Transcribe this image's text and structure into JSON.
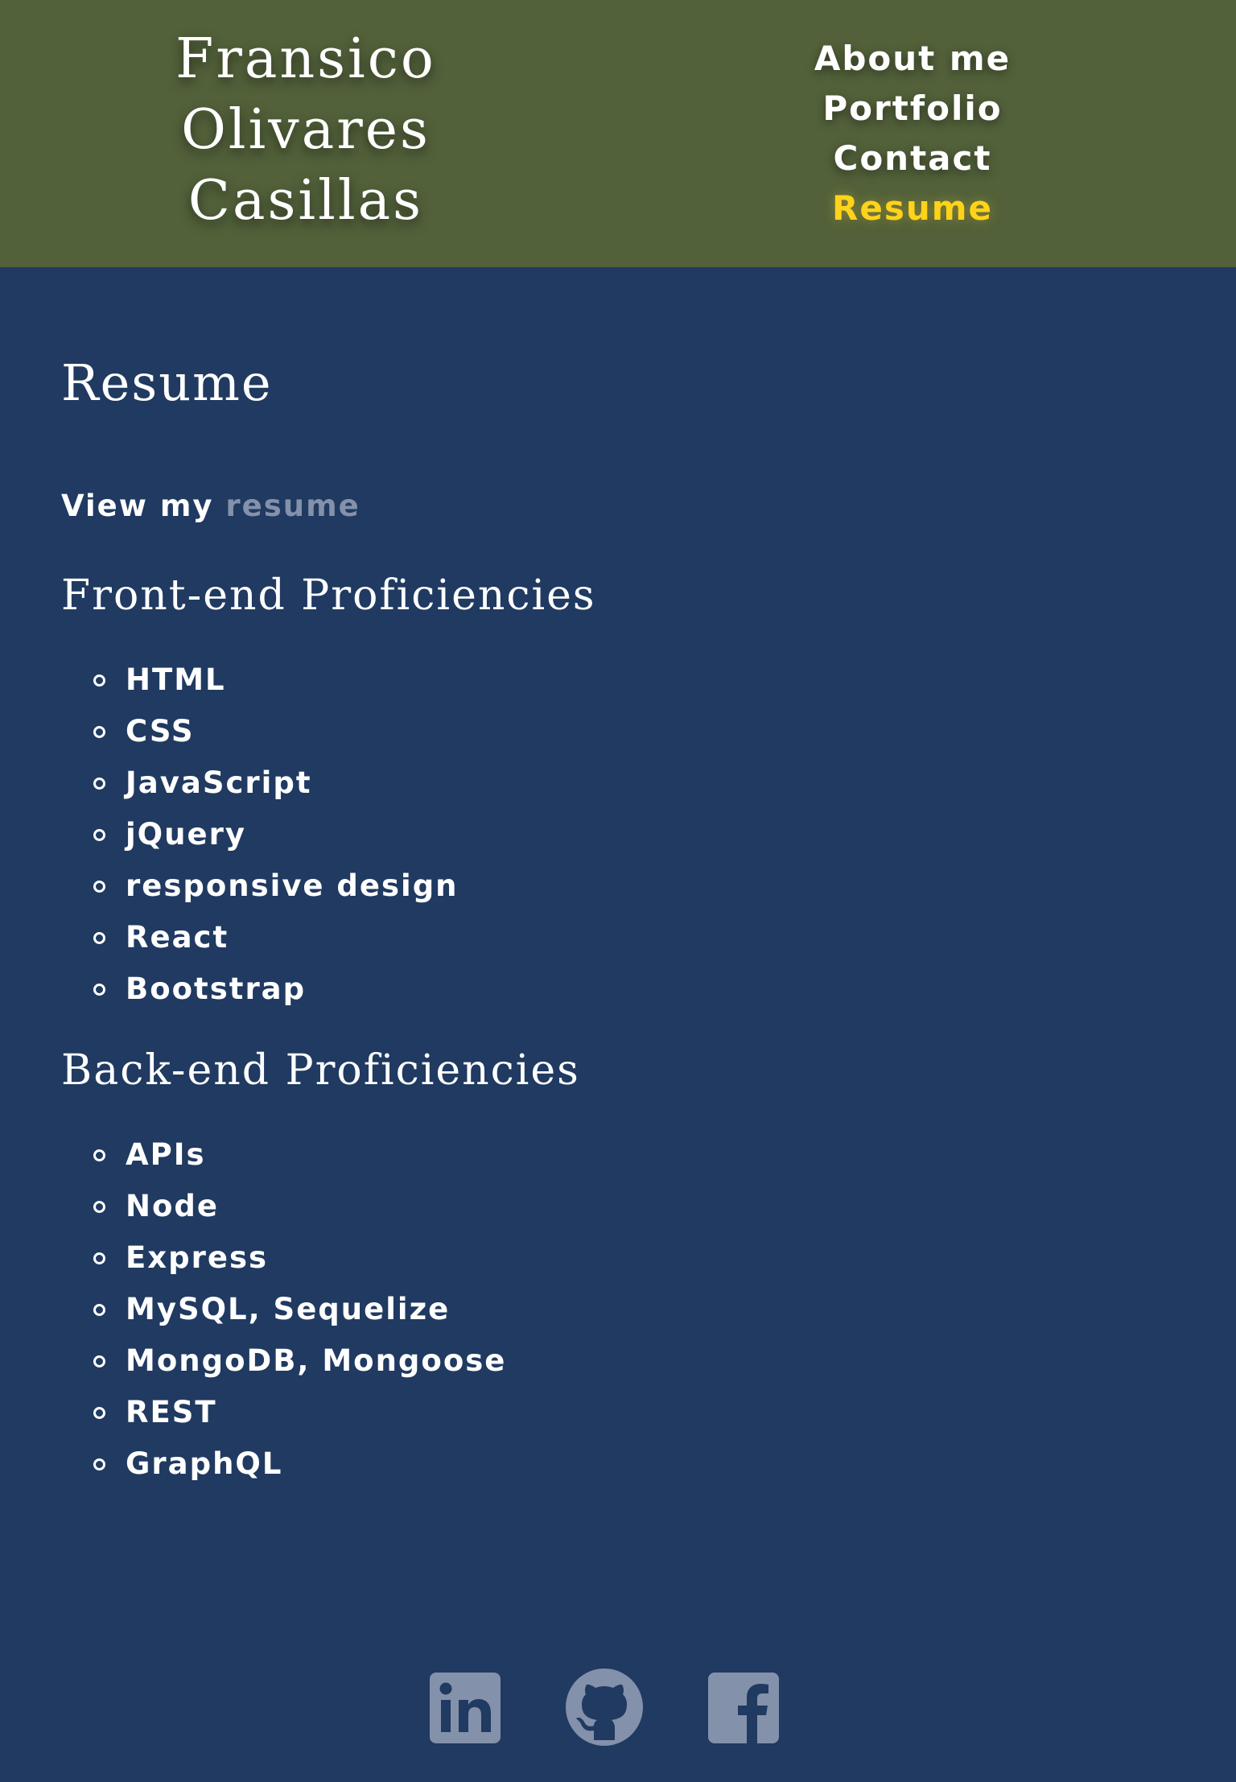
{
  "header": {
    "title_line1": "Fransico Olivares",
    "title_line2": "Casillas"
  },
  "nav": {
    "items": [
      {
        "label": "About me"
      },
      {
        "label": "Portfolio"
      },
      {
        "label": "Contact"
      },
      {
        "label": "Resume",
        "active": true
      }
    ]
  },
  "colors": {
    "header_bg": "#52613a",
    "page_bg": "#203a61",
    "active_link": "#ffd31a",
    "muted_link": "#8491aa",
    "icon": "#8491aa"
  },
  "main": {
    "heading": "Resume",
    "resume_prefix": "View my",
    "resume_link": "resume",
    "frontend": {
      "heading": "Front-end Proficiencies",
      "items": [
        "HTML",
        "CSS",
        "JavaScript",
        "jQuery",
        "responsive design",
        "React",
        "Bootstrap"
      ]
    },
    "backend": {
      "heading": "Back-end Proficiencies",
      "items": [
        "APIs",
        "Node",
        "Express",
        "MySQL, Sequelize",
        "MongoDB, Mongoose",
        "REST",
        "GraphQL"
      ]
    }
  },
  "footer": {
    "icons": [
      "linkedin-icon",
      "github-icon",
      "facebook-icon"
    ]
  }
}
